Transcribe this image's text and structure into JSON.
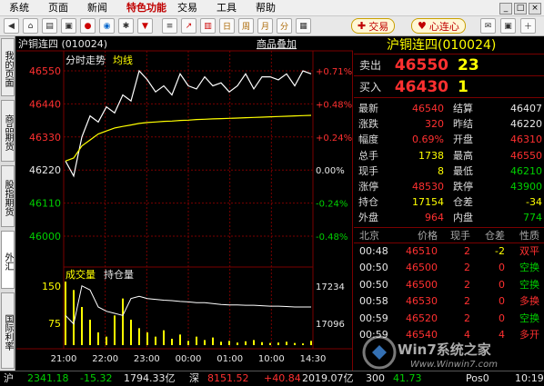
{
  "menu": {
    "items": [
      "系统",
      "页面",
      "新闻",
      "特色功能",
      "交易",
      "工具",
      "帮助"
    ],
    "trade_button": "交易",
    "heart_button": "心连心",
    "window_controls": [
      "_",
      "□",
      "×"
    ]
  },
  "left_tabs": [
    "我的页面",
    "商品期货",
    "股指期货",
    "外汇",
    "国际利率"
  ],
  "left_tabs_active_index": 3,
  "chart_header": {
    "instrument": "沪铜连四 (010024)",
    "overlay_link": "商品叠加",
    "intraday_label": "分时走势",
    "avg_label": "均线",
    "volume_label": "成交量",
    "oi_label": "持仓量"
  },
  "chart_data": {
    "type": "line",
    "price_axis": {
      "ticks": [
        "46550",
        "46440",
        "46330",
        "46220",
        "46110",
        "46000"
      ],
      "pct_ticks": [
        "+0.71%",
        "+0.48%",
        "+0.24%",
        "0.00%",
        "-0.24%",
        "-0.48%"
      ],
      "ylim": [
        46000,
        46550
      ],
      "prev_settle": 46220
    },
    "volume_axis": {
      "left_ticks": [
        "150",
        "75"
      ],
      "right_ticks": [
        "17234",
        "17096"
      ]
    },
    "time_ticks": [
      "21:00",
      "22:00",
      "23:00",
      "00:00",
      "01:00",
      "10:00",
      "14:30"
    ],
    "series": [
      {
        "values": [
          46250,
          46200,
          46330,
          46400,
          46380,
          46430,
          46410,
          46470,
          46450,
          46550,
          46520,
          46480,
          46500,
          46470,
          46540,
          46500,
          46490,
          46530,
          46500,
          46510,
          46480,
          46500,
          46540,
          46490,
          46530,
          46530,
          46520,
          46540,
          46500,
          46550,
          46540
        ]
      },
      {
        "values": [
          46250,
          46260,
          46300,
          46320,
          46340,
          46350,
          46360,
          46365,
          46370,
          46375,
          46378,
          46380,
          46382,
          46383,
          46385,
          46386,
          46388,
          46389,
          46390,
          46391,
          46392,
          46393,
          46394,
          46395,
          46396,
          46397,
          46398,
          46399,
          46400,
          46401,
          46402
        ]
      }
    ],
    "volumes": [
      150,
      130,
      90,
      60,
      30,
      20,
      70,
      110,
      60,
      40,
      30,
      20,
      35,
      15,
      25,
      10,
      20,
      12,
      18,
      8,
      10,
      6,
      9,
      12,
      7,
      5,
      6,
      8,
      5,
      4,
      10
    ],
    "open_interest": [
      17160,
      17140,
      17230,
      17220,
      17180,
      17170,
      17165,
      17160,
      17200,
      17205,
      17200,
      17198,
      17196,
      17195,
      17193,
      17192,
      17190,
      17190,
      17188,
      17186,
      17185,
      17185,
      17184,
      17184,
      17183,
      17182,
      17182,
      17181,
      17180,
      17180,
      17180
    ]
  },
  "panel": {
    "title": "沪铜连四(010024)",
    "ask": {
      "label": "卖出",
      "price": "46550",
      "vol": "23"
    },
    "bid": {
      "label": "买入",
      "price": "46430",
      "vol": "1"
    },
    "stats": [
      {
        "l": "最新",
        "v": "46540",
        "vc": "red",
        "l2": "结算",
        "v2": "46407",
        "v2c": "white"
      },
      {
        "l": "涨跌",
        "v": "320",
        "vc": "red",
        "l2": "昨结",
        "v2": "46220",
        "v2c": "white"
      },
      {
        "l": "幅度",
        "v": "0.69%",
        "vc": "red",
        "l2": "开盘",
        "v2": "46310",
        "v2c": "red"
      },
      {
        "l": "总手",
        "v": "1738",
        "vc": "yellow",
        "l2": "最高",
        "v2": "46550",
        "v2c": "red"
      },
      {
        "l": "现手",
        "v": "8",
        "vc": "yellow",
        "l2": "最低",
        "v2": "46210",
        "v2c": "green"
      },
      {
        "l": "涨停",
        "v": "48530",
        "vc": "red",
        "l2": "跌停",
        "v2": "43900",
        "v2c": "green"
      },
      {
        "l": "持仓",
        "v": "17154",
        "vc": "yellow",
        "l2": "仓差",
        "v2": "-34",
        "v2c": "yellow"
      },
      {
        "l": "外盘",
        "v": "964",
        "vc": "red",
        "l2": "内盘",
        "v2": "774",
        "v2c": "green"
      }
    ],
    "ticks_header": [
      "北京",
      "价格",
      "现手",
      "仓差",
      "性质"
    ],
    "ticks": [
      {
        "t": "00:48",
        "p": "46510",
        "pc": "red",
        "q": "2",
        "oi": "-2",
        "oic": "yellow",
        "n": "双平",
        "nc": "red"
      },
      {
        "t": "00:50",
        "p": "46500",
        "pc": "red",
        "q": "2",
        "oi": "0",
        "oic": "red",
        "n": "空换",
        "nc": "green"
      },
      {
        "t": "00:50",
        "p": "46500",
        "pc": "red",
        "q": "2",
        "oi": "0",
        "oic": "red",
        "n": "空换",
        "nc": "green"
      },
      {
        "t": "00:58",
        "p": "46530",
        "pc": "red",
        "q": "2",
        "oi": "0",
        "oic": "red",
        "n": "多换",
        "nc": "red"
      },
      {
        "t": "00:59",
        "p": "46520",
        "pc": "red",
        "q": "2",
        "oi": "0",
        "oic": "red",
        "n": "空换",
        "nc": "green"
      },
      {
        "t": "00:59",
        "p": "46540",
        "pc": "red",
        "q": "4",
        "oi": "4",
        "oic": "red",
        "n": "多开",
        "nc": "red"
      }
    ]
  },
  "status": {
    "sh_label": "沪",
    "sh_index": "2341.18",
    "sh_change": "-15.32",
    "sh_amount": "1794.33亿",
    "sz_label": "深",
    "sz_index": "8151.52",
    "sz_change": "+40.84",
    "sz_amount": "2019.07亿",
    "partial": "300",
    "right_a": "41.73",
    "right_b": "Pos0",
    "right_c": "10:19"
  },
  "watermark": {
    "text": "Win7系统之家",
    "url": "Www.Winwin7.com"
  }
}
